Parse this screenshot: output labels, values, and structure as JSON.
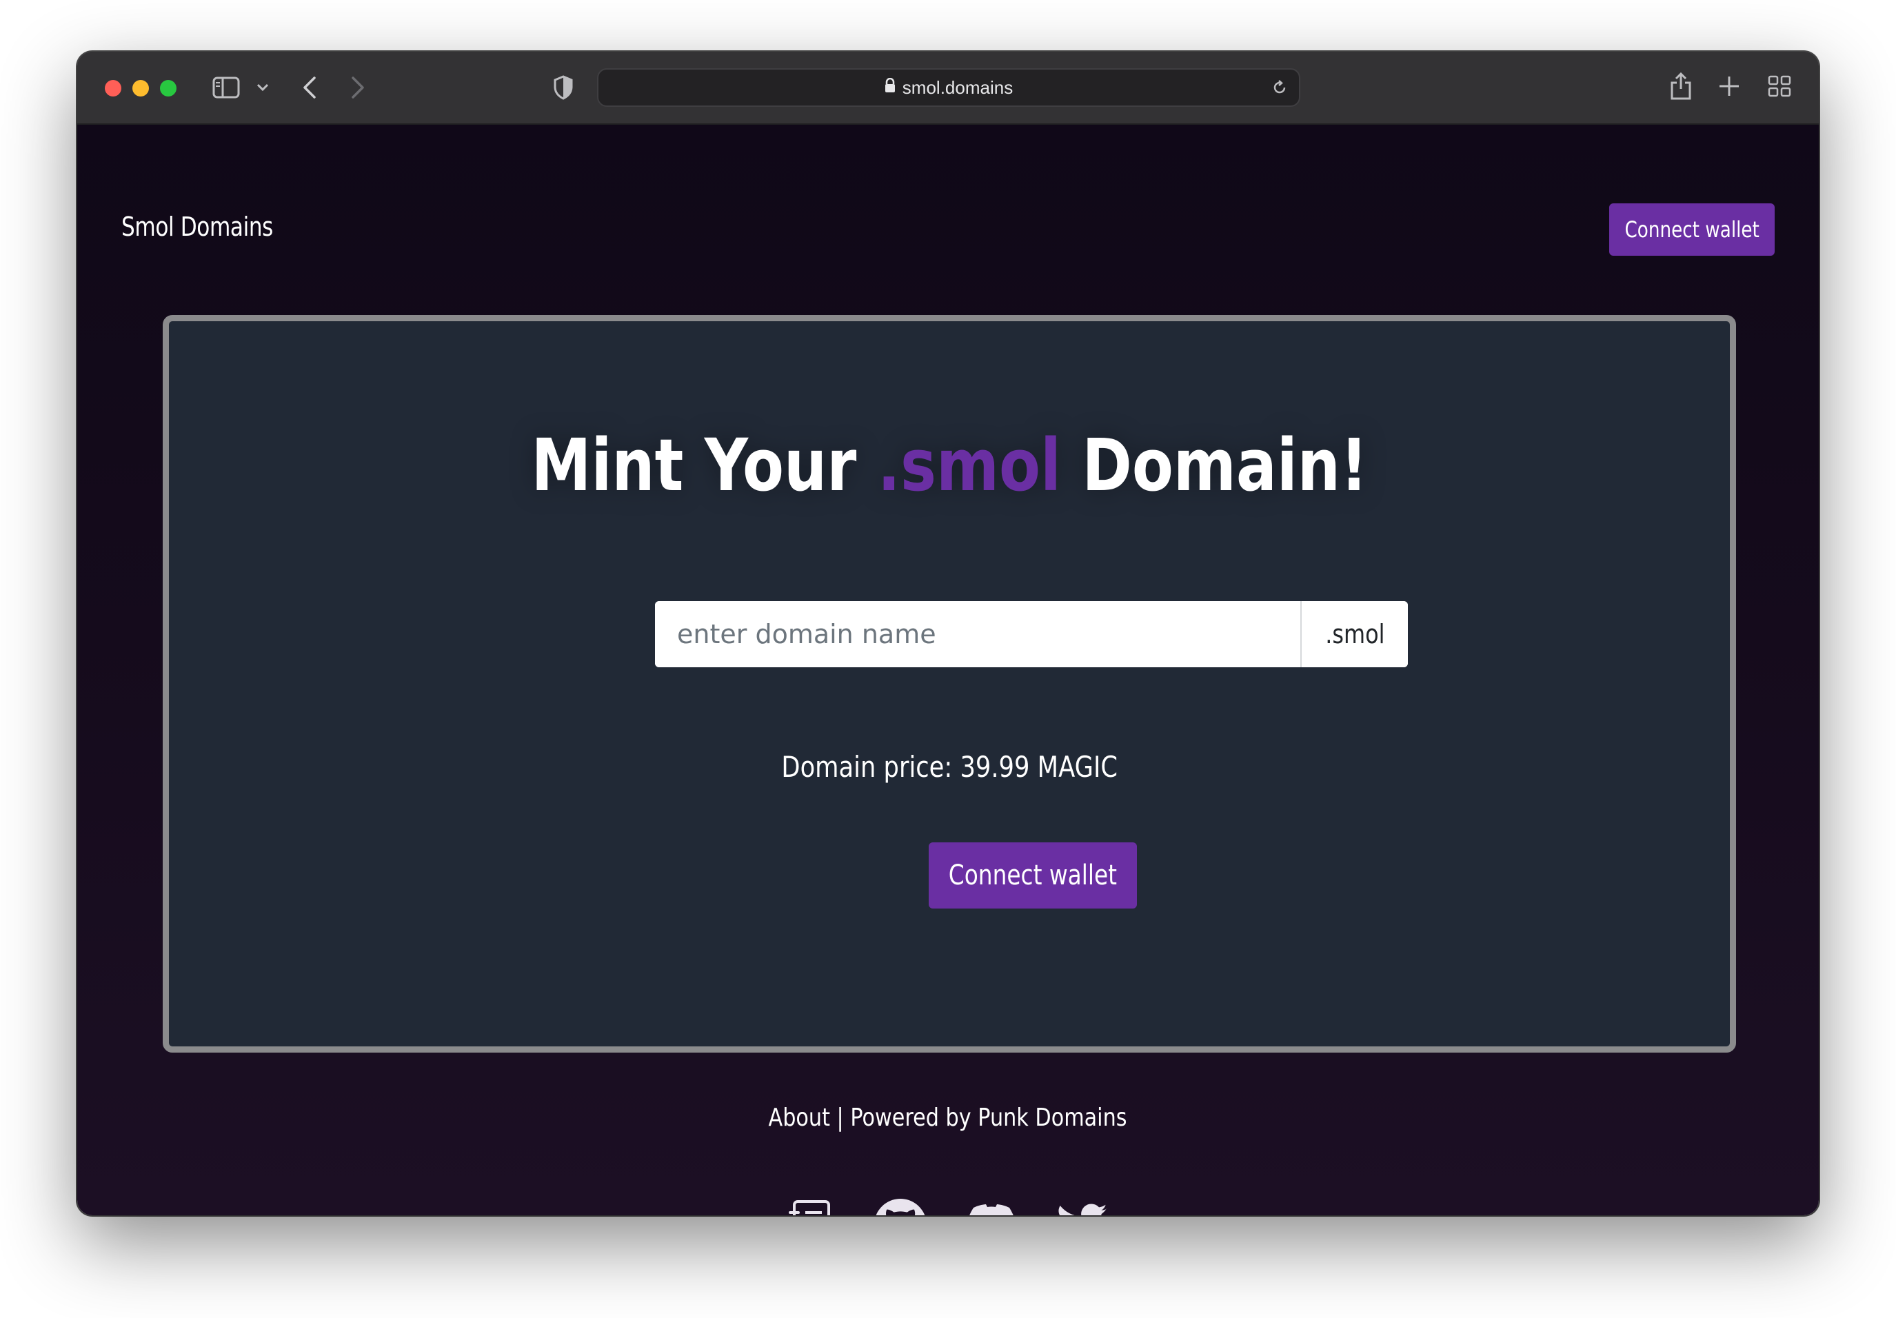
{
  "browser": {
    "url": "smol.domains",
    "controls": [
      "close",
      "minimize",
      "zoom",
      "sidebar-toggle",
      "tab-group-menu",
      "back",
      "forward",
      "privacy-shield",
      "reload",
      "share",
      "new-tab",
      "tab-overview"
    ]
  },
  "navbar": {
    "brand": "Smol Domains",
    "connect_label": "Connect wallet"
  },
  "mint": {
    "title_prefix": "Mint Your",
    "title_accent": ".smol",
    "title_suffix": "Domain!",
    "input_placeholder": "enter domain name",
    "input_value": "",
    "tld": ".smol",
    "price_text": "Domain price: 39.99 MAGIC",
    "connect_label": "Connect wallet"
  },
  "footer": {
    "about": "About",
    "separator": "|",
    "powered_by": "Powered by Punk Domains",
    "social_icons": [
      "docs-icon",
      "github-icon",
      "discord-icon",
      "twitter-icon"
    ]
  },
  "colors": {
    "accent": "#6a2fa3",
    "card_bg": "#212936",
    "card_border": "#8b8b8d",
    "page_bg": "#150b1c",
    "titlebar": "#333234"
  }
}
